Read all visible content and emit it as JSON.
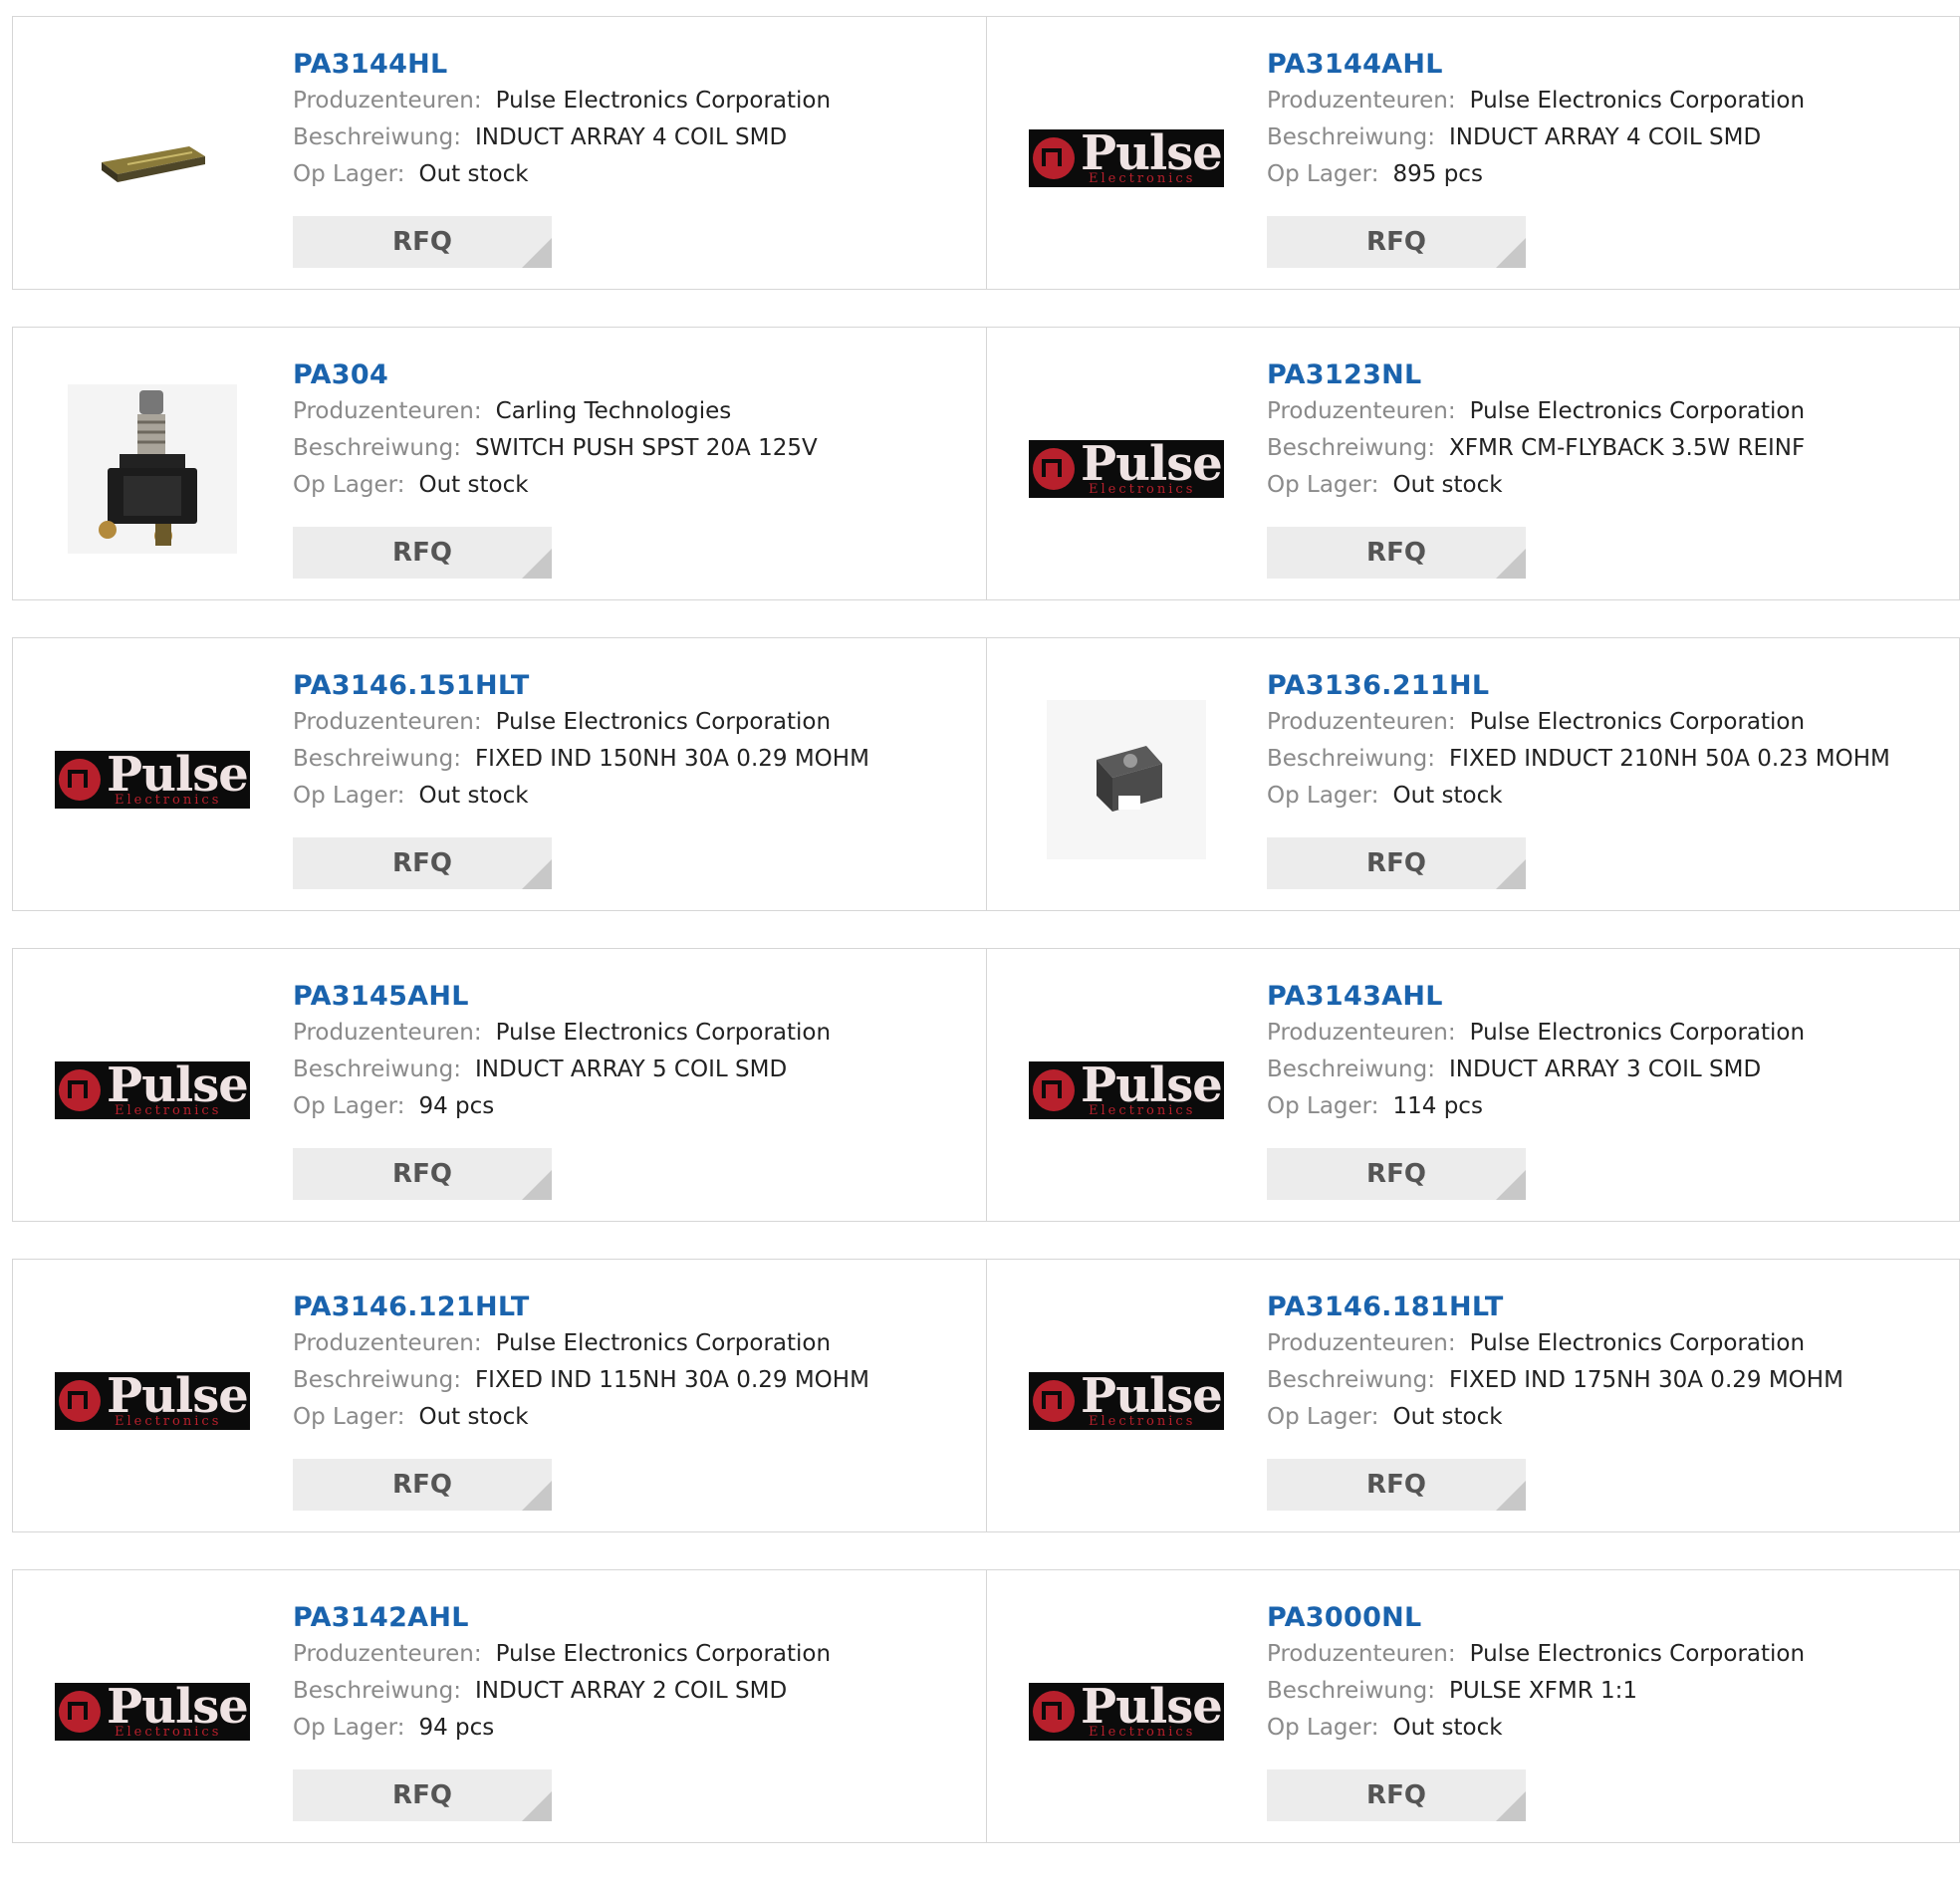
{
  "labels": {
    "manufacturer": "Produzenteuren:",
    "description": "Beschreiwung:",
    "stock": "Op Lager:",
    "rfq": "RFQ"
  },
  "logo": {
    "word": "Pulse",
    "sub": "Electronics"
  },
  "products": [
    {
      "pn": "PA3144HL",
      "manufacturer": "Pulse Electronics Corporation",
      "description": "INDUCT ARRAY 4 COIL SMD",
      "stock": "Out stock",
      "image": "inductor-array-photo"
    },
    {
      "pn": "PA3144AHL",
      "manufacturer": "Pulse Electronics Corporation",
      "description": "INDUCT ARRAY 4 COIL SMD",
      "stock": "895 pcs",
      "image": "pulse-logo"
    },
    {
      "pn": "PA304",
      "manufacturer": "Carling Technologies",
      "description": "SWITCH PUSH SPST 20A 125V",
      "stock": "Out stock",
      "image": "push-switch-photo"
    },
    {
      "pn": "PA3123NL",
      "manufacturer": "Pulse Electronics Corporation",
      "description": "XFMR CM-FLYBACK 3.5W REINF",
      "stock": "Out stock",
      "image": "pulse-logo"
    },
    {
      "pn": "PA3146.151HLT",
      "manufacturer": "Pulse Electronics Corporation",
      "description": "FIXED IND 150NH 30A 0.29 MOHM",
      "stock": "Out stock",
      "image": "pulse-logo"
    },
    {
      "pn": "PA3136.211HL",
      "manufacturer": "Pulse Electronics Corporation",
      "description": "FIXED INDUCT 210NH 50A 0.23 MOHM",
      "stock": "Out stock",
      "image": "inductor-photo"
    },
    {
      "pn": "PA3145AHL",
      "manufacturer": "Pulse Electronics Corporation",
      "description": "INDUCT ARRAY 5 COIL SMD",
      "stock": "94 pcs",
      "image": "pulse-logo"
    },
    {
      "pn": "PA3143AHL",
      "manufacturer": "Pulse Electronics Corporation",
      "description": "INDUCT ARRAY 3 COIL SMD",
      "stock": "114 pcs",
      "image": "pulse-logo"
    },
    {
      "pn": "PA3146.121HLT",
      "manufacturer": "Pulse Electronics Corporation",
      "description": "FIXED IND 115NH 30A 0.29 MOHM",
      "stock": "Out stock",
      "image": "pulse-logo"
    },
    {
      "pn": "PA3146.181HLT",
      "manufacturer": "Pulse Electronics Corporation",
      "description": "FIXED IND 175NH 30A 0.29 MOHM",
      "stock": "Out stock",
      "image": "pulse-logo"
    },
    {
      "pn": "PA3142AHL",
      "manufacturer": "Pulse Electronics Corporation",
      "description": "INDUCT ARRAY 2 COIL SMD",
      "stock": "94 pcs",
      "image": "pulse-logo"
    },
    {
      "pn": "PA3000NL",
      "manufacturer": "Pulse Electronics Corporation",
      "description": "PULSE XFMR 1:1",
      "stock": "Out stock",
      "image": "pulse-logo"
    }
  ]
}
